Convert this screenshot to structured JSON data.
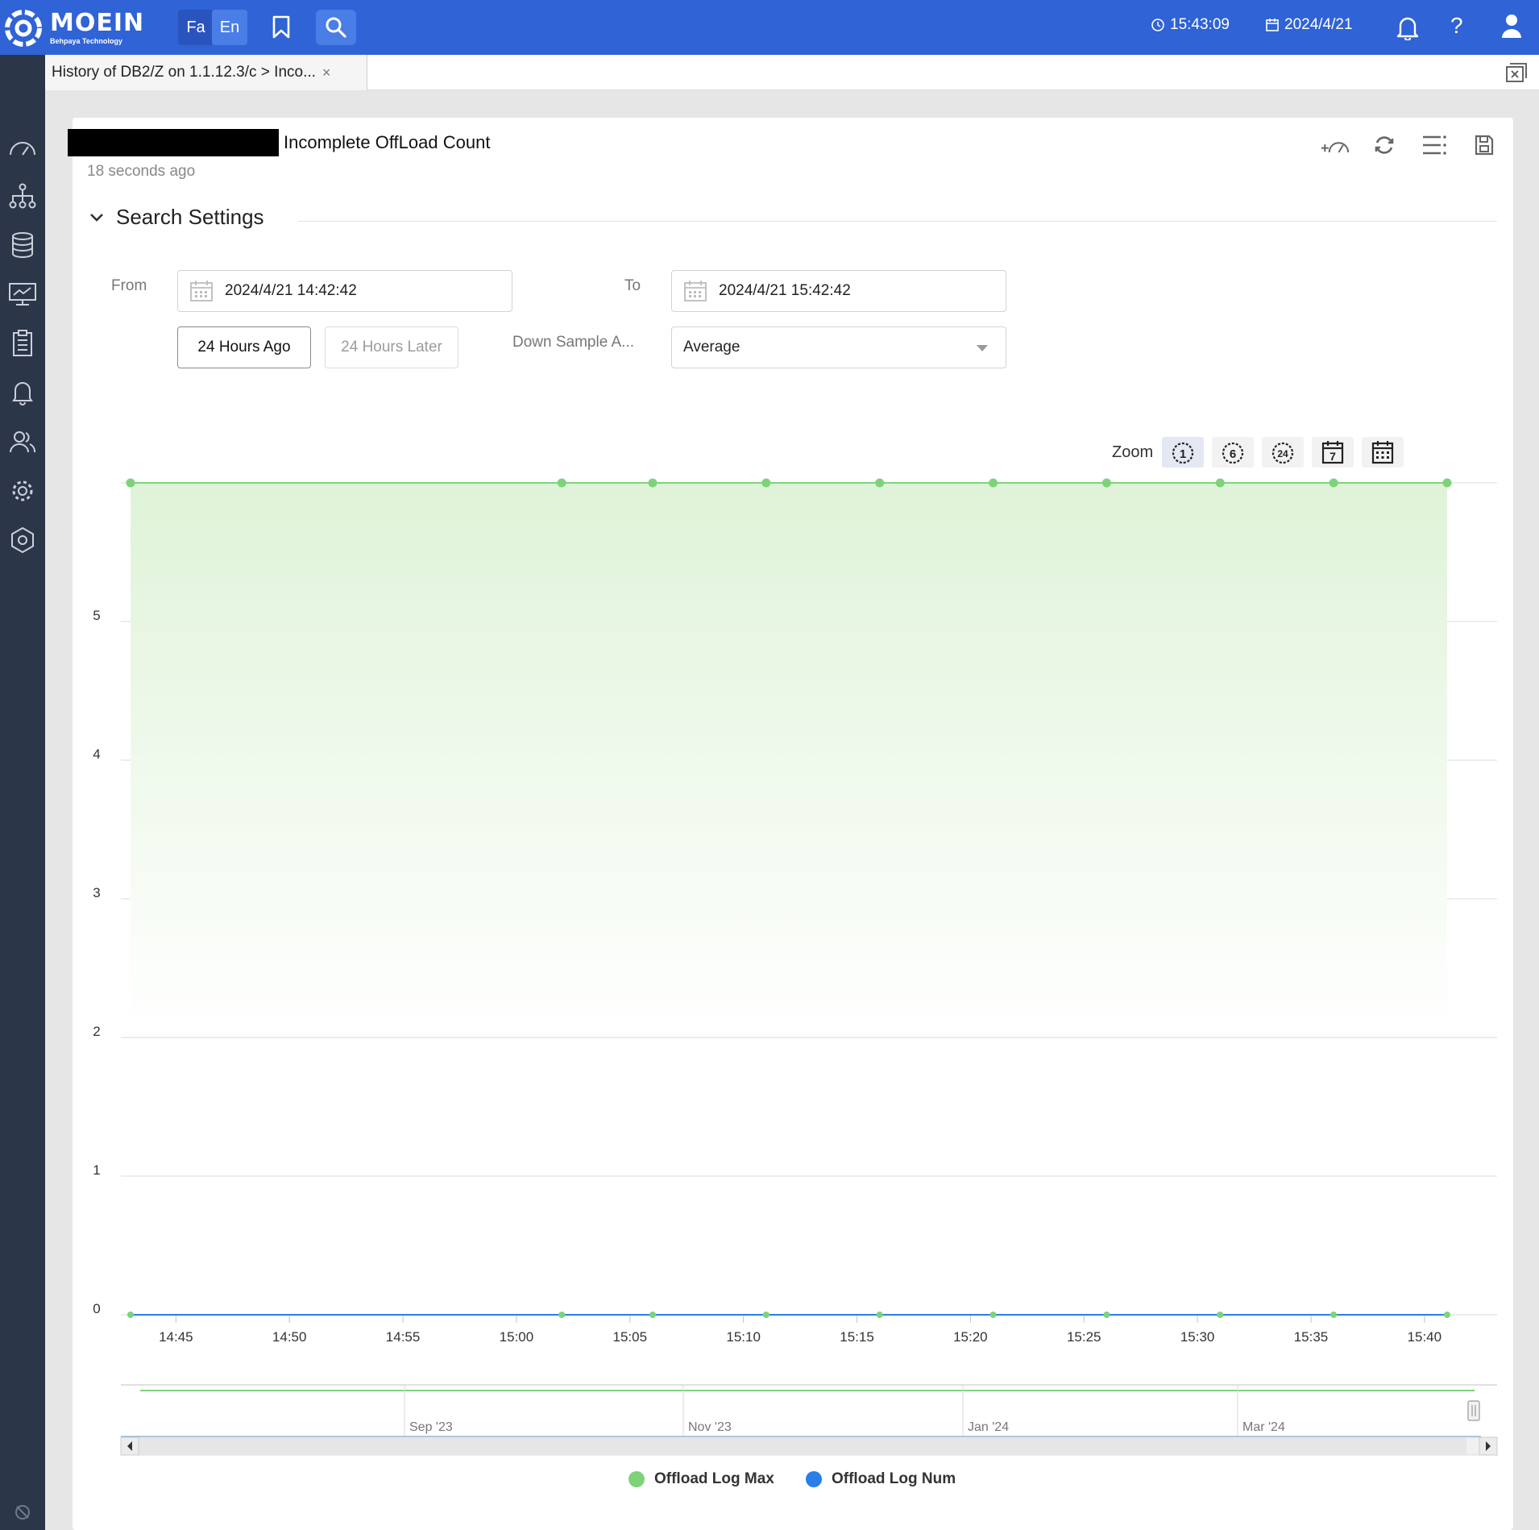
{
  "topbar": {
    "brand": "MOEIN",
    "brand_sub": "Behpaya Technology",
    "lang_fa": "Fa",
    "lang_en": "En",
    "time": "15:43:09",
    "date": "2024/4/21",
    "help": "?"
  },
  "tab": {
    "label": "History of DB2/Z on 1.1.12.3/c > Inco...",
    "close": "×"
  },
  "card": {
    "title": "Incomplete OffLoad Count",
    "updated": "18 seconds ago"
  },
  "search_settings": {
    "title": "Search Settings",
    "from_label": "From",
    "from_value": "2024/4/21 14:42:42",
    "to_label": "To",
    "to_value": "2024/4/21 15:42:42",
    "btn_prev": "24 Hours Ago",
    "btn_next": "24 Hours Later",
    "downsample_label": "Down Sample A...",
    "downsample_value": "Average"
  },
  "zoom": {
    "label": "Zoom",
    "buttons": [
      "1",
      "6",
      "24",
      "7",
      "calendar"
    ]
  },
  "colors": {
    "accent": "#2f63d6",
    "series_max": "#7ed37a",
    "series_num": "#2a7ee8"
  },
  "chart_data": {
    "type": "area",
    "title": "",
    "xlabel": "",
    "ylabel": "",
    "ylim": [
      0,
      6
    ],
    "yticks": [
      0,
      1,
      2,
      3,
      4,
      5
    ],
    "xticks": [
      "14:45",
      "14:50",
      "14:55",
      "15:00",
      "15:05",
      "15:10",
      "15:15",
      "15:20",
      "15:25",
      "15:30",
      "15:35",
      "15:40"
    ],
    "x": [
      "14:43",
      "15:02",
      "15:06",
      "15:11",
      "15:16",
      "15:21",
      "15:26",
      "15:31",
      "15:36",
      "15:41"
    ],
    "series": [
      {
        "name": "Offload Log Max",
        "type": "area",
        "values": [
          6,
          6,
          6,
          6,
          6,
          6,
          6,
          6,
          6,
          6
        ]
      },
      {
        "name": "Offload Log Num",
        "type": "line",
        "values": [
          0,
          0,
          0,
          0,
          0,
          0,
          0,
          0,
          0,
          0
        ]
      }
    ],
    "navigator_labels": [
      "Sep '23",
      "Nov '23",
      "Jan '24",
      "Mar '24"
    ],
    "legend_position": "bottom-center",
    "grid": true
  }
}
